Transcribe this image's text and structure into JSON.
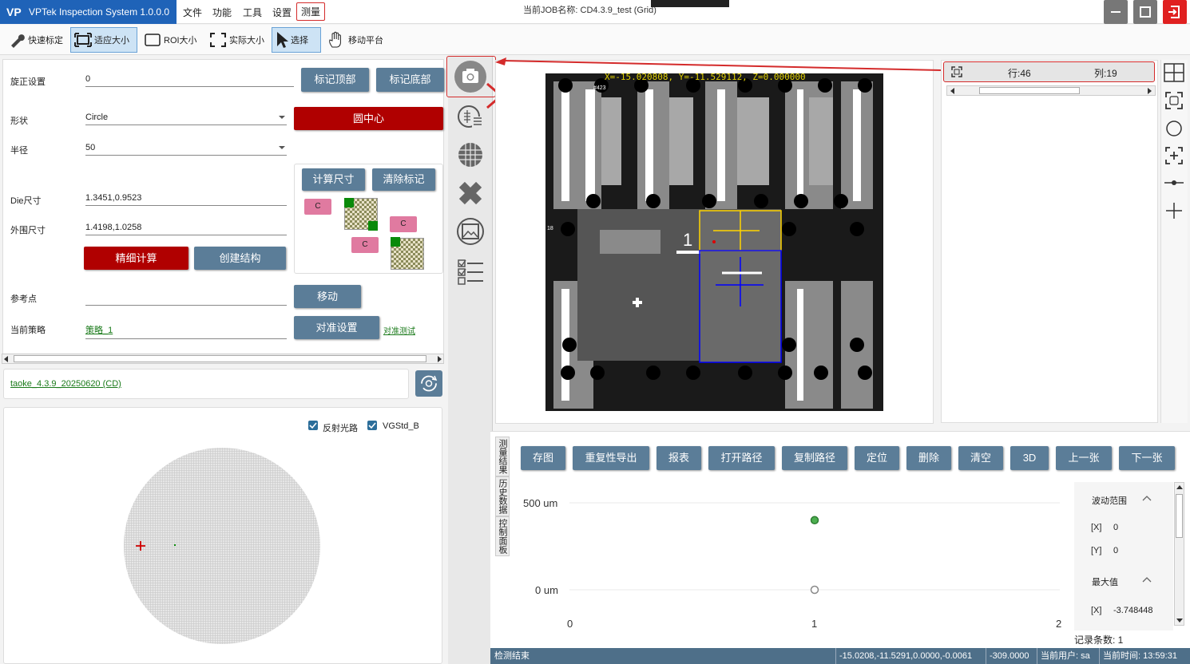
{
  "app": {
    "title": "VPTek Inspection System 1.0.0.0",
    "logo": "VP",
    "job": "当前JOB名称: CD4.3.9_test (Grid)"
  },
  "menu": [
    "文件",
    "功能",
    "工具",
    "设置",
    "测量"
  ],
  "toolbar": {
    "quick": "快速标定",
    "fit": "适应大小",
    "roi": "ROI大小",
    "actual": "实际大小",
    "select": "选择",
    "move": "移动平台"
  },
  "left": {
    "rotate_label": "旋正设置",
    "rotate_value": "0",
    "mark_top": "标记顶部",
    "mark_bottom": "标记底部",
    "shape_label": "形状",
    "shape_value": "Circle",
    "circle_center": "圆中心",
    "radius_label": "半径",
    "radius_value": "50",
    "calc": "计算尺寸",
    "clear": "清除标记",
    "die_label": "Die尺寸",
    "die_value": "1.3451,0.9523",
    "outer_label": "外围尺寸",
    "outer_value": "1.4198,1.0258",
    "fine": "精细计算",
    "create": "创建结构",
    "ref_label": "参考点",
    "move": "移动",
    "strategy_label": "当前策略",
    "strategy_value": "策略_1",
    "align": "对准设置",
    "align_test": "对准测试",
    "c": "C"
  },
  "recipe": "taoke_4.3.9_20250620 (CD)",
  "wafer": {
    "reflect": "反射光路",
    "vgstd": "VGStd_B"
  },
  "image": {
    "coord": "X=-15.020808, Y=-11.529112, Z=0.000000",
    "die_num": "1",
    "label_423": "#423",
    "label_18": "18"
  },
  "rowcol": {
    "row": "行:46",
    "col": "列:19"
  },
  "bottom_buttons": [
    "存图",
    "重复性导出",
    "报表",
    "打开路径",
    "复制路径",
    "定位",
    "删除",
    "清空",
    "3D",
    "上一张",
    "下一张"
  ],
  "vtabs": [
    "测量结果",
    "历史数据",
    "控制面板"
  ],
  "chart_data": {
    "type": "scatter",
    "x": [
      1,
      1
    ],
    "y": [
      400,
      0
    ],
    "ylabels": [
      "500 um",
      "0 um"
    ],
    "xlabels": [
      "0",
      "1",
      "2"
    ],
    "xlim": [
      0,
      2
    ],
    "series_colors": [
      "#4caf50",
      "#ffffff"
    ]
  },
  "stats": {
    "range_title": "波动范围",
    "x_label": "[X]",
    "x_val": "0",
    "y_label": "[Y]",
    "y_val": "0",
    "max_title": "最大值",
    "max_x_label": "[X]",
    "max_x_val": "-3.748448",
    "count": "记录条数: 1"
  },
  "status": {
    "left": "检测结束",
    "coords": "-15.0208,-11.5291,0.0000,-0.0061",
    "z": "-309.0000",
    "user": "当前用户: sa",
    "time": "当前时间: 13:59:31"
  }
}
